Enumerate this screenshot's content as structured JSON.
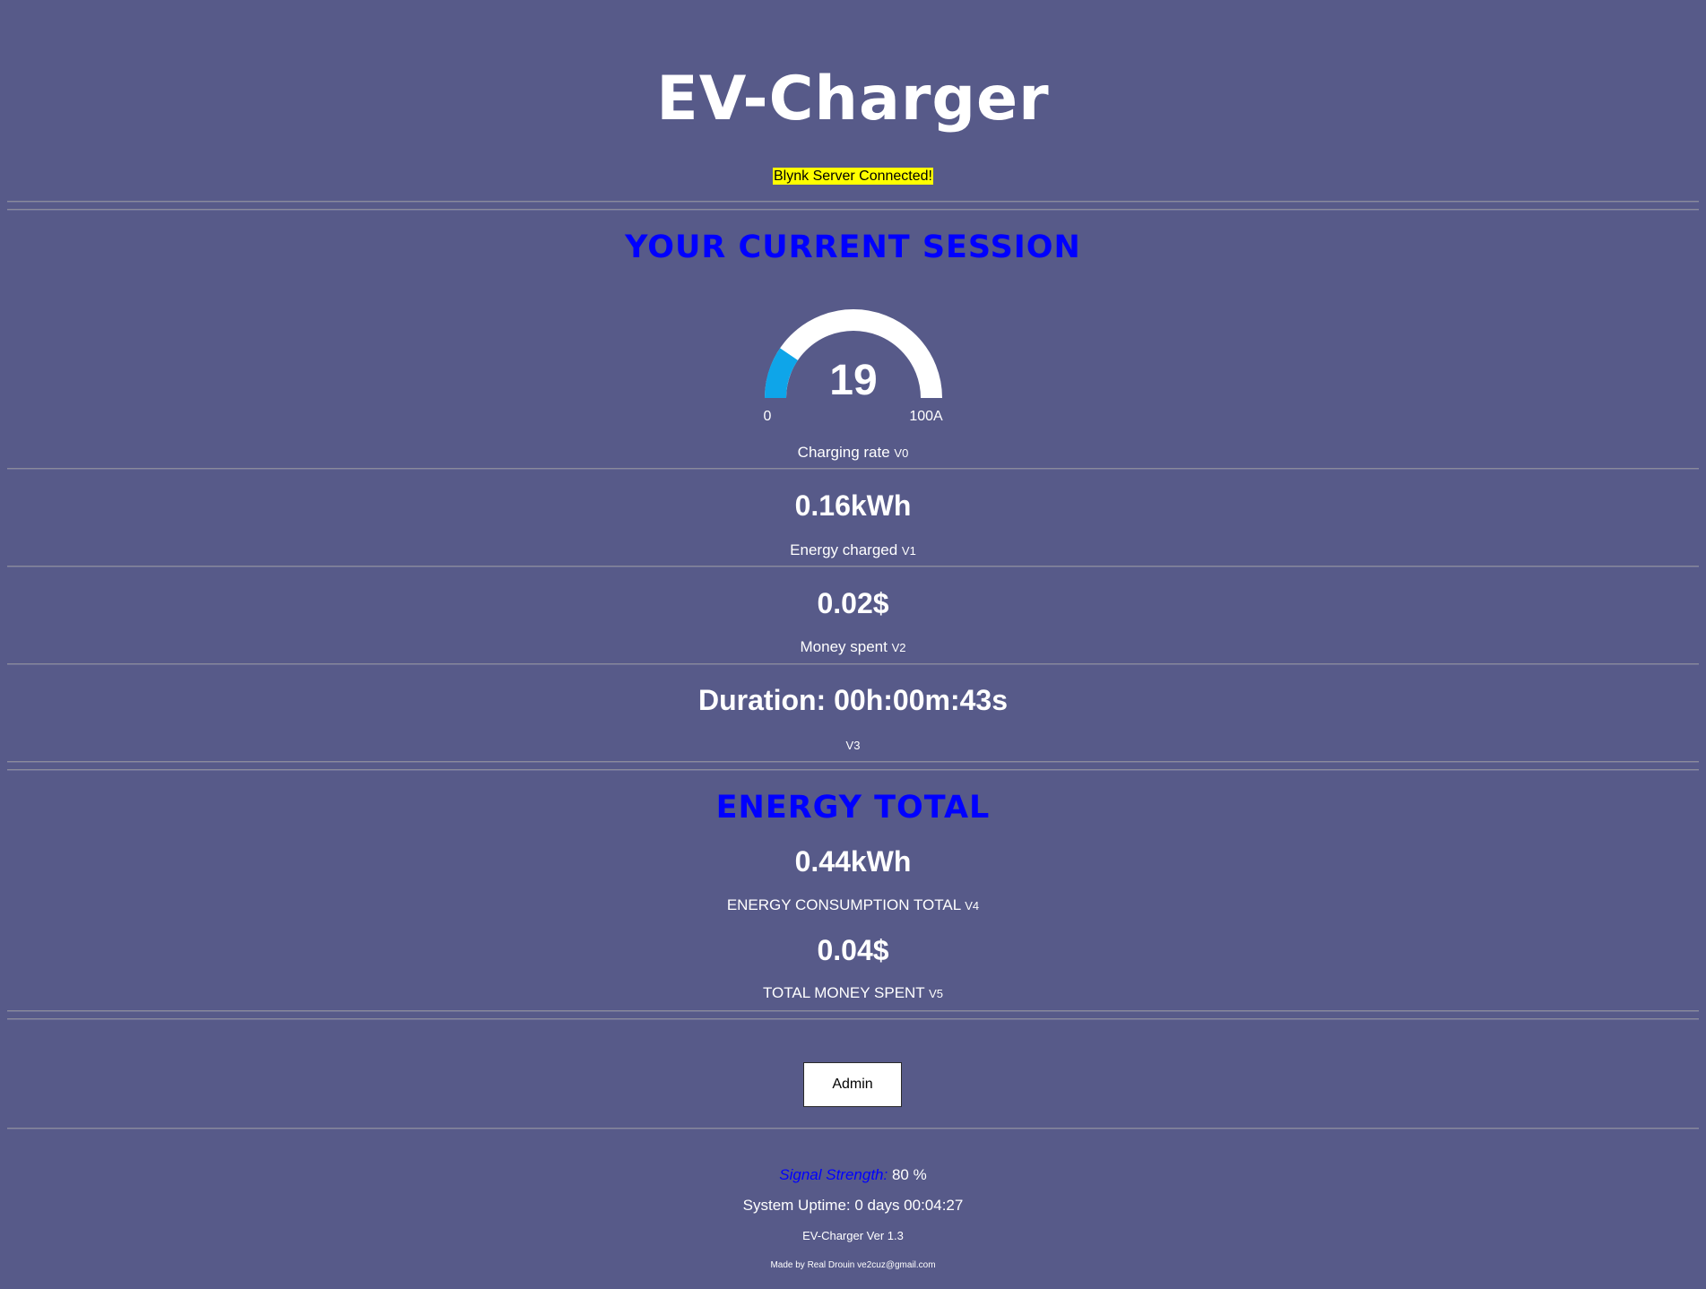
{
  "page": {
    "title": "EV-Charger",
    "status": "Blynk Server Connected!",
    "colors": {
      "background": "#575a89",
      "section_heading": "#0000ff",
      "status_highlight": "#ffff00",
      "gauge_fill": "#0ea5e9",
      "gauge_track": "#ffffff"
    }
  },
  "session": {
    "heading": "YOUR CURRENT SESSION",
    "gauge": {
      "value": "19",
      "min_label": "0",
      "max_label": "100A",
      "value_fraction": 0.19
    },
    "charging_rate": {
      "label": "Charging rate",
      "pin": "V0"
    },
    "energy": {
      "value": "0.16kWh",
      "label": "Energy charged",
      "pin": "V1"
    },
    "money": {
      "value": "0.02$",
      "label": "Money spent",
      "pin": "V2"
    },
    "duration": {
      "value": "Duration: 00h:00m:43s",
      "pin": "V3"
    }
  },
  "totals": {
    "heading": "ENERGY TOTAL",
    "energy": {
      "value": "0.44kWh",
      "label": "ENERGY CONSUMPTION TOTAL",
      "pin": "V4"
    },
    "money": {
      "value": "0.04$",
      "label": "TOTAL MONEY SPENT",
      "pin": "V5"
    }
  },
  "admin_button": "Admin",
  "footer": {
    "signal_label": "Signal Strength:",
    "signal_value": "80 %",
    "uptime": "System Uptime: 0 days 00:04:27",
    "version": "EV-Charger Ver 1.3",
    "credit": "Made by Real Drouin ve2cuz@gmail.com"
  }
}
